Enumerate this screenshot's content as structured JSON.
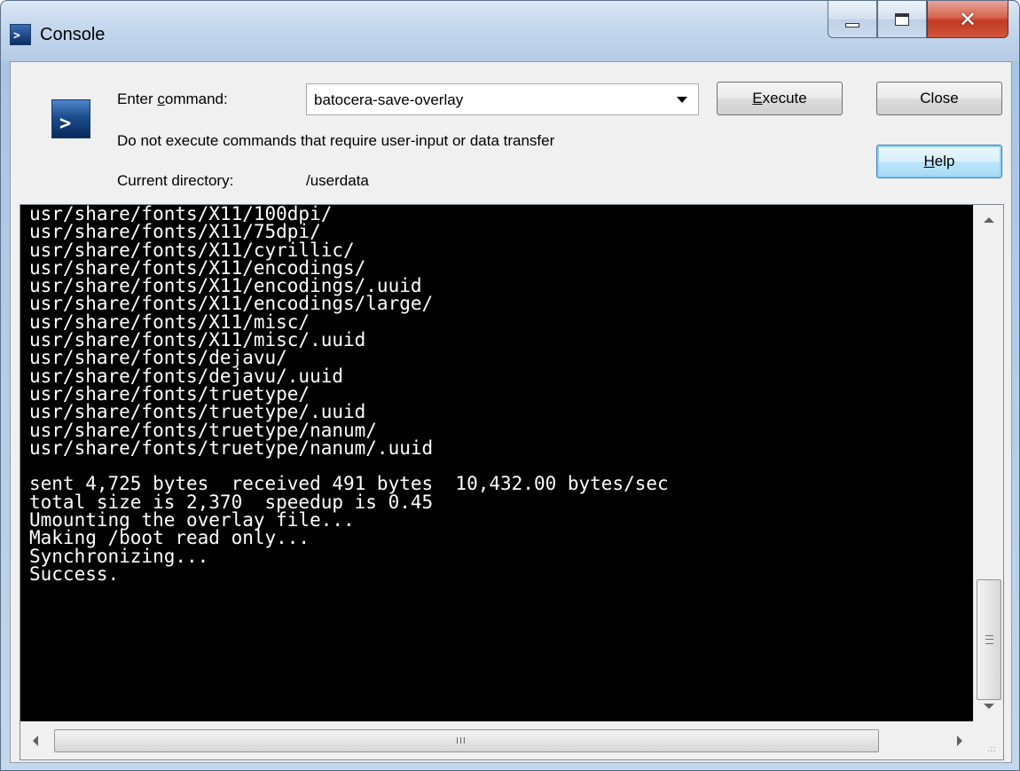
{
  "window": {
    "title": "Console",
    "title_icon": "console-prompt-icon",
    "minimize_icon": "minimize-icon",
    "maximize_icon": "maximize-icon",
    "close_icon": "close-icon"
  },
  "command_panel": {
    "icon": "console-prompt-icon",
    "command_label_pre": "Enter ",
    "command_label_accel": "c",
    "command_label_post": "ommand:",
    "command_value": "batocera-save-overlay",
    "warning_text": "Do not execute commands that require user-input or data transfer",
    "directory_label": "Current directory:",
    "directory_value": "/userdata",
    "execute_accel": "E",
    "execute_rest": "xecute",
    "close_label": "Close",
    "help_accel": "H",
    "help_rest": "elp"
  },
  "console": {
    "lines": [
      "usr/share/fonts/X11/100dpi/",
      "usr/share/fonts/X11/75dpi/",
      "usr/share/fonts/X11/cyrillic/",
      "usr/share/fonts/X11/encodings/",
      "usr/share/fonts/X11/encodings/.uuid",
      "usr/share/fonts/X11/encodings/large/",
      "usr/share/fonts/X11/misc/",
      "usr/share/fonts/X11/misc/.uuid",
      "usr/share/fonts/dejavu/",
      "usr/share/fonts/dejavu/.uuid",
      "usr/share/fonts/truetype/",
      "usr/share/fonts/truetype/.uuid",
      "usr/share/fonts/truetype/nanum/",
      "usr/share/fonts/truetype/nanum/.uuid",
      "",
      "sent 4,725 bytes  received 491 bytes  10,432.00 bytes/sec",
      "total size is 2,370  speedup is 0.45",
      "Umounting the overlay file...",
      "Making /boot read only...",
      "Synchronizing...",
      "Success."
    ],
    "hscroll_grip": "III",
    "size_grip": ".::"
  }
}
